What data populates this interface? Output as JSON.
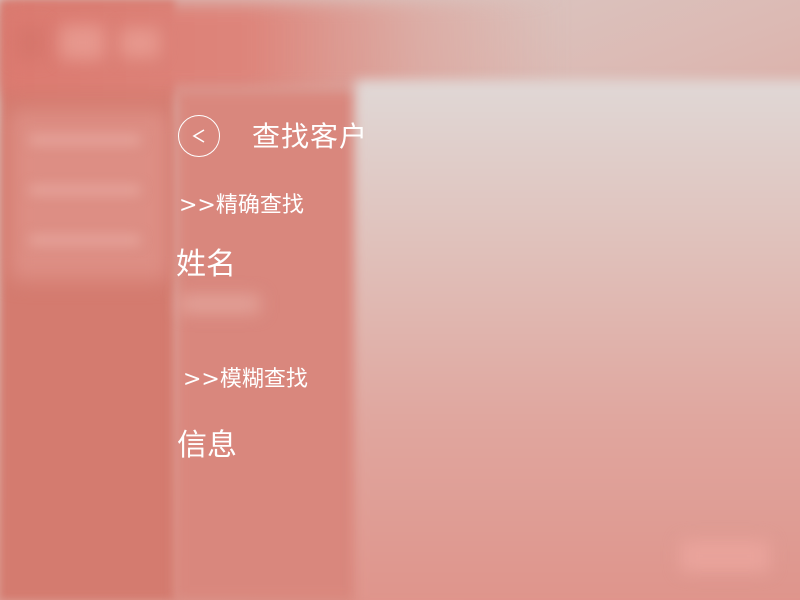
{
  "header": {
    "back_icon": "chevron-left-icon",
    "title": "查找客户"
  },
  "exact_search": {
    "label": ">>精确查找",
    "field_label": "姓名"
  },
  "fuzzy_search": {
    "label": ">>模糊查找",
    "field_label": "信息"
  },
  "colors": {
    "overlay_text": "#ffffff",
    "background_accent": "#d47b6f"
  }
}
